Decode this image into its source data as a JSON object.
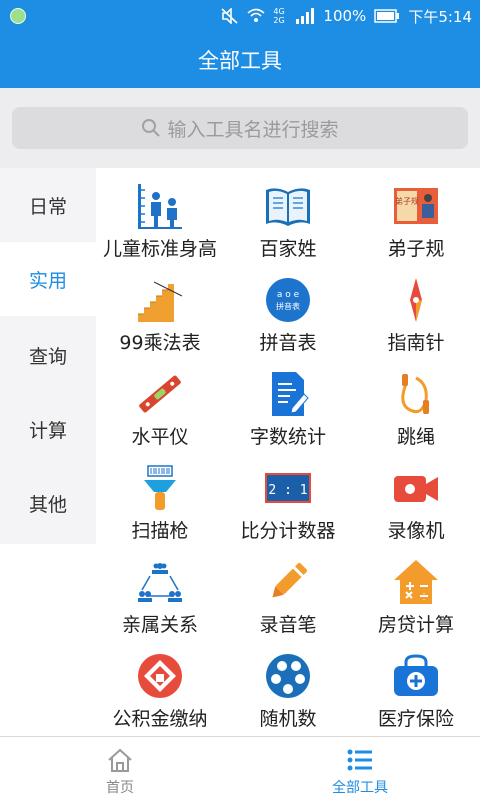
{
  "status": {
    "battery": "100%",
    "time": "下午5:14",
    "network_label": "4G 2G"
  },
  "header": {
    "title": "全部工具"
  },
  "search": {
    "placeholder": "输入工具名进行搜索"
  },
  "sidebar": {
    "items": [
      {
        "label": "日常",
        "active": false
      },
      {
        "label": "实用",
        "active": true
      },
      {
        "label": "查询",
        "active": false
      },
      {
        "label": "计算",
        "active": false
      },
      {
        "label": "其他",
        "active": false
      }
    ]
  },
  "tools": [
    {
      "label": "儿童标准身高",
      "icon": "child-height-icon"
    },
    {
      "label": "百家姓",
      "icon": "book-icon"
    },
    {
      "label": "弟子规",
      "icon": "scroll-book-icon"
    },
    {
      "label": "99乘法表",
      "icon": "multiplication-table-icon"
    },
    {
      "label": "拼音表",
      "icon": "pinyin-icon"
    },
    {
      "label": "指南针",
      "icon": "compass-icon"
    },
    {
      "label": "水平仪",
      "icon": "level-icon"
    },
    {
      "label": "字数统计",
      "icon": "document-icon"
    },
    {
      "label": "跳绳",
      "icon": "jump-rope-icon"
    },
    {
      "label": "扫描枪",
      "icon": "barcode-scanner-icon"
    },
    {
      "label": "比分计数器",
      "icon": "scoreboard-icon"
    },
    {
      "label": "录像机",
      "icon": "video-camera-icon"
    },
    {
      "label": "亲属关系",
      "icon": "family-icon"
    },
    {
      "label": "录音笔",
      "icon": "pen-icon"
    },
    {
      "label": "房贷计算",
      "icon": "house-calculator-icon"
    },
    {
      "label": "公积金缴纳",
      "icon": "housing-fund-icon"
    },
    {
      "label": "随机数",
      "icon": "random-number-icon"
    },
    {
      "label": "医疗保险",
      "icon": "medical-bag-icon"
    }
  ],
  "icon_text": {
    "scroll": "弟子规",
    "pinyin_top": "a o e",
    "pinyin_bottom": "拼音表",
    "score": "2 : 1"
  },
  "tabbar": {
    "items": [
      {
        "label": "首页",
        "active": false
      },
      {
        "label": "全部工具",
        "active": true
      }
    ]
  },
  "colors": {
    "primary": "#1e8de4",
    "accent_red": "#e64b3c",
    "accent_orange": "#f39c2b"
  }
}
